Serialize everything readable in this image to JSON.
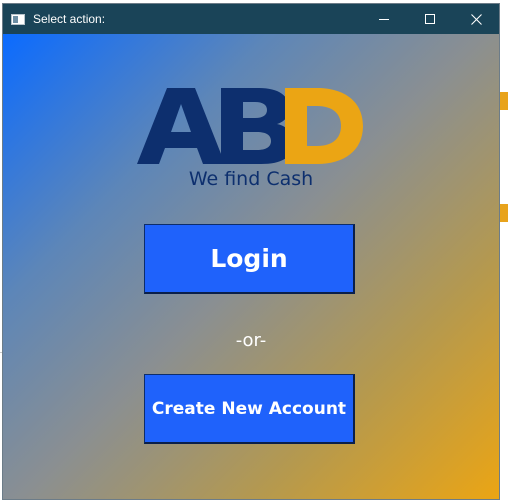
{
  "window": {
    "title": "Select action:"
  },
  "titlebar_buttons": {
    "minimize": "minimize-icon",
    "maximize": "maximize-icon",
    "close": "close-icon"
  },
  "logo": {
    "letters": [
      "A",
      "B",
      "D"
    ],
    "colors": {
      "primary": "#0d2f6e",
      "accent": "#eba514"
    }
  },
  "tagline": "We find Cash",
  "buttons": {
    "login": "Login",
    "create_account": "Create New Account"
  },
  "separator": "-or-",
  "colors": {
    "titlebar": "#1a4458",
    "button": "#1f62fb",
    "gradient_start": "#0b6bff",
    "gradient_end": "#eba514"
  }
}
